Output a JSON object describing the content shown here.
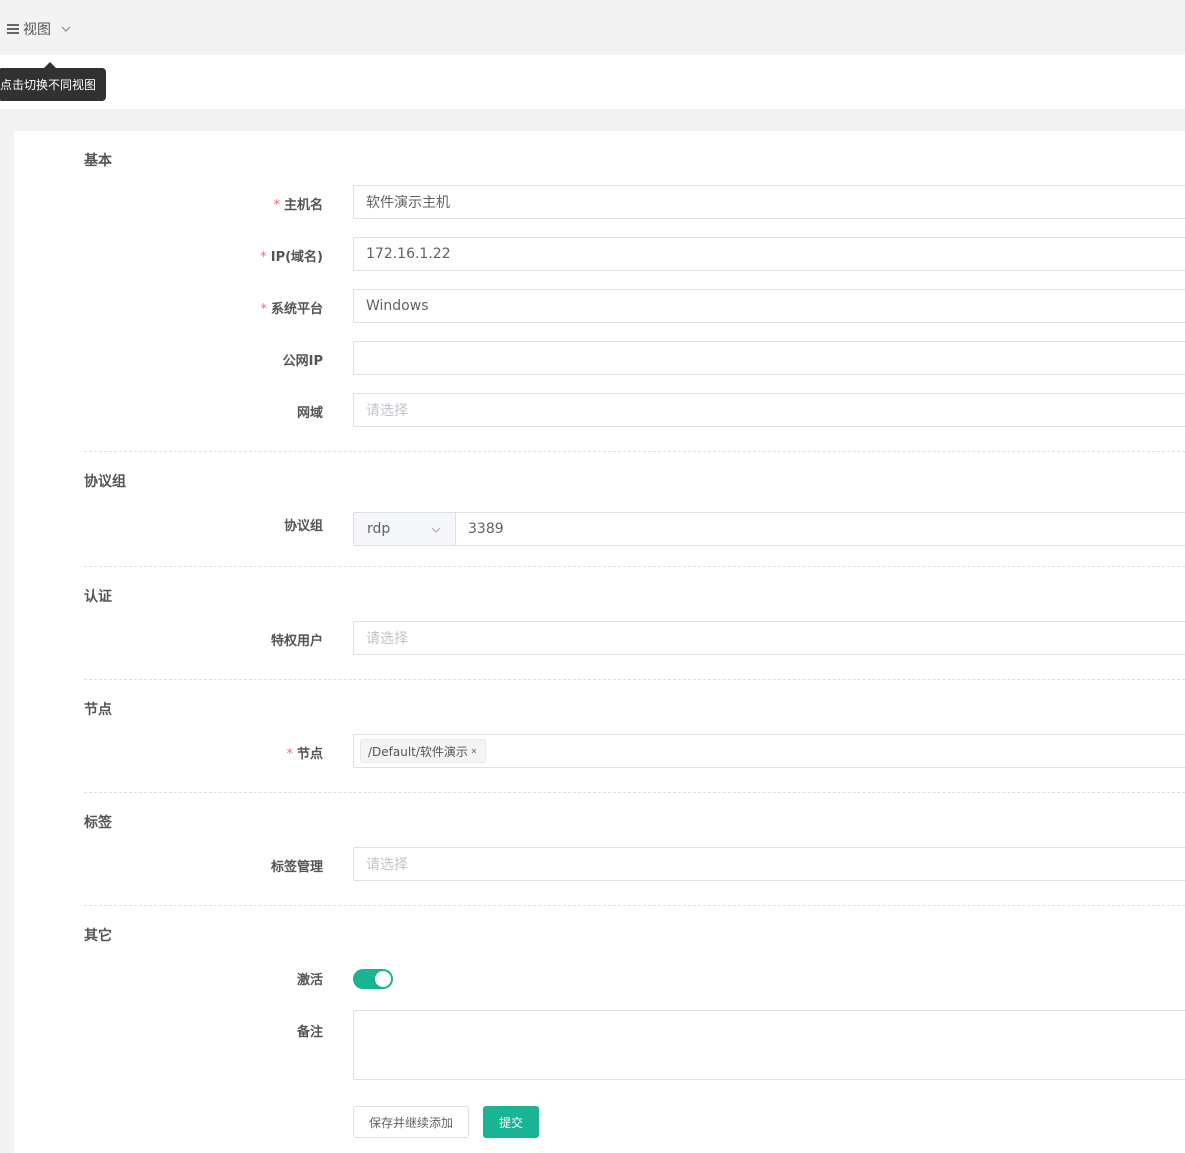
{
  "topbar": {
    "view_label": "视图"
  },
  "tooltip": {
    "text": "点击切换不同视图"
  },
  "sections": {
    "basic": "基本",
    "protocols": "协议组",
    "auth": "认证",
    "nodes": "节点",
    "labels": "标签",
    "other": "其它"
  },
  "fields": {
    "hostname": {
      "label": "主机名",
      "required": "*",
      "value": "软件演示主机"
    },
    "ip": {
      "label": "IP(域名)",
      "required": "*",
      "value": "172.16.1.22"
    },
    "platform": {
      "label": "系统平台",
      "required": "*",
      "value": "Windows"
    },
    "public_ip": {
      "label": "公网IP",
      "value": ""
    },
    "domain": {
      "label": "网域",
      "placeholder": "请选择"
    },
    "protocol_group": {
      "label": "协议组",
      "protocol": "rdp",
      "port": "3389"
    },
    "admin_user": {
      "label": "特权用户",
      "placeholder": "请选择"
    },
    "node": {
      "label": "节点",
      "required": "*",
      "tag": "/Default/软件演示"
    },
    "label_mgmt": {
      "label": "标签管理",
      "placeholder": "请选择"
    },
    "active": {
      "label": "激活",
      "enabled": true
    },
    "comment": {
      "label": "备注",
      "value": ""
    }
  },
  "buttons": {
    "save_continue": "保存并继续添加",
    "submit": "提交"
  },
  "colors": {
    "primary": "#1ab394",
    "required": "#f56c6c"
  }
}
